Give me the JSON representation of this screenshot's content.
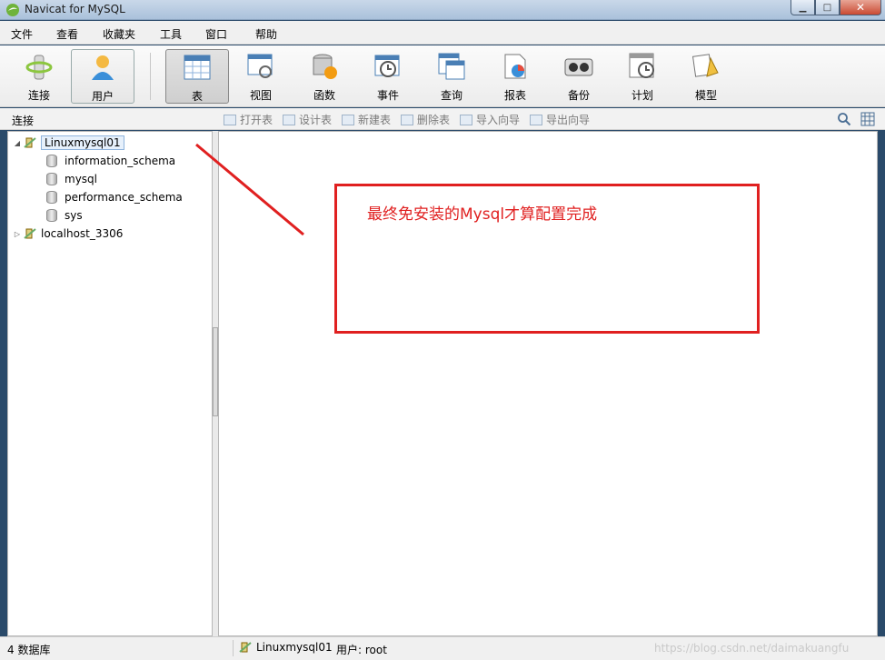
{
  "window": {
    "title": "Navicat for MySQL"
  },
  "menu": [
    "文件",
    "查看",
    "收藏夹",
    "工具",
    "窗口",
    "帮助"
  ],
  "toolbar": {
    "items": [
      {
        "label": "连接",
        "icon": "connection-icon"
      },
      {
        "label": "用户",
        "icon": "user-icon"
      },
      {
        "label": "表",
        "icon": "table-icon"
      },
      {
        "label": "视图",
        "icon": "view-icon"
      },
      {
        "label": "函数",
        "icon": "function-icon"
      },
      {
        "label": "事件",
        "icon": "event-icon"
      },
      {
        "label": "查询",
        "icon": "query-icon"
      },
      {
        "label": "报表",
        "icon": "report-icon"
      },
      {
        "label": "备份",
        "icon": "backup-icon"
      },
      {
        "label": "计划",
        "icon": "schedule-icon"
      },
      {
        "label": "模型",
        "icon": "model-icon"
      }
    ]
  },
  "subbar": {
    "connection_label": "连接",
    "actions": [
      "打开表",
      "设计表",
      "新建表",
      "删除表",
      "导入向导",
      "导出向导"
    ]
  },
  "tree": {
    "connections": [
      {
        "name": "Linuxmysql01",
        "expanded": true,
        "databases": [
          "information_schema",
          "mysql",
          "performance_schema",
          "sys"
        ]
      },
      {
        "name": "localhost_3306",
        "expanded": false,
        "databases": []
      }
    ]
  },
  "annotation": {
    "text": "最终免安装的Mysql才算配置完成",
    "color": "#e02020"
  },
  "status": {
    "db_count": "4 数据库",
    "connection": "Linuxmysql01",
    "user": "用户: root",
    "watermark": "https://blog.csdn.net/daimakuangfu"
  }
}
